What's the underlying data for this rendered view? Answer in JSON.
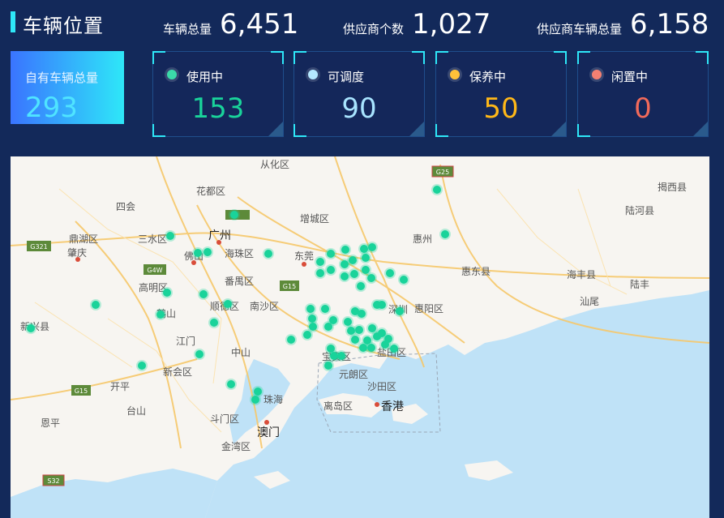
{
  "header": {
    "title": "车辆位置",
    "total": {
      "label": "车辆总量",
      "value": "6,451"
    },
    "supplier_count": {
      "label": "供应商个数",
      "value": "1,027"
    },
    "supplier_vehicles": {
      "label": "供应商车辆总量",
      "value": "6,158"
    }
  },
  "own_vehicles": {
    "label": "自有车辆总量",
    "value": "293"
  },
  "status_cards": [
    {
      "label": "使用中",
      "value": "153",
      "color": "#19d39a"
    },
    {
      "label": "可调度",
      "value": "90",
      "color": "#a8e4ff"
    },
    {
      "label": "保养中",
      "value": "50",
      "color": "#ffb818"
    },
    {
      "label": "闲置中",
      "value": "0",
      "color": "#f26a5a"
    }
  ],
  "map": {
    "place_labels": [
      "从化区",
      "揭西县",
      "花都区",
      "四会",
      "增城区",
      "陆河县",
      "鼎湖区",
      "三水区",
      "广州",
      "惠州",
      "肇庆",
      "佛山",
      "海珠区",
      "东莞",
      "惠东县",
      "海丰县",
      "高明区",
      "番禺区",
      "陆丰",
      "南沙区",
      "顺德区",
      "鹤山",
      "深圳",
      "惠阳区",
      "汕尾",
      "新兴县",
      "江门",
      "宝安区",
      "盐田区",
      "中山",
      "新会区",
      "元朗区",
      "开平",
      "沙田区",
      "珠海",
      "离岛区",
      "香港",
      "台山",
      "斗门区",
      "澳门",
      "金湾区",
      "恩平"
    ],
    "road_shields": [
      "G25",
      "G321",
      "G4W",
      "G15",
      "G15",
      "S32"
    ],
    "marker_color": "#19d39a"
  }
}
